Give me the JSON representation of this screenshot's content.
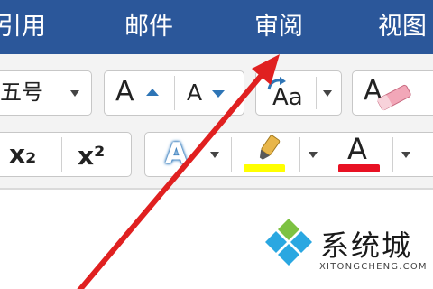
{
  "tabs": [
    {
      "label": "引用"
    },
    {
      "label": "邮件"
    },
    {
      "label": "审阅"
    },
    {
      "label": "视图"
    }
  ],
  "font_size": {
    "value": "五号"
  },
  "buttons": {
    "grow_font": "A",
    "shrink_font": "A",
    "change_case": "Aa",
    "subscript": "x₂",
    "superscript": "x²",
    "text_effects": "A",
    "font_color": "A"
  },
  "colors": {
    "tab_bar": "#2b579a",
    "arrow": "#e02020",
    "highlight": "#ffff00",
    "font_color_bar": "#e81123",
    "accent_blue": "#2e75b6"
  },
  "watermark": {
    "brand": "系统城",
    "url": "XITONGCHENG.COM"
  }
}
